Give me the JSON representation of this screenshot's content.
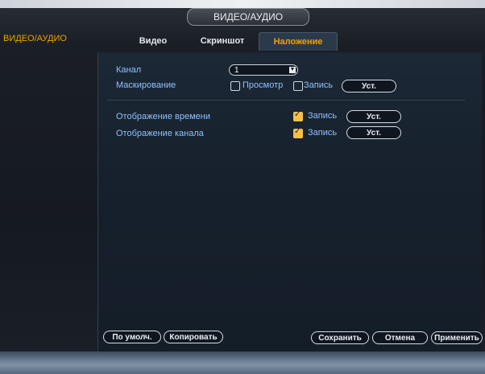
{
  "window": {
    "title": "ВИДЕО/АУДИО"
  },
  "sidebar": {
    "items": [
      {
        "label": "ВИДЕО/АУДИО",
        "active": true
      }
    ]
  },
  "tabs": [
    {
      "label": "Видео",
      "active": false
    },
    {
      "label": "Скриншот",
      "active": false
    },
    {
      "label": "Наложение",
      "active": true
    }
  ],
  "overlay": {
    "channel": {
      "label": "Канал",
      "value": "1"
    },
    "masking": {
      "label": "Маскирование",
      "preview": {
        "label": "Просмотр",
        "checked": false
      },
      "record": {
        "label": "Запись",
        "checked": false
      },
      "setup_label": "Уст."
    },
    "time_display": {
      "label": "Отображение времени",
      "record": {
        "label": "Запись",
        "checked": true
      },
      "setup_label": "Уст."
    },
    "channel_display": {
      "label": "Отображение канала",
      "record": {
        "label": "Запись",
        "checked": true
      },
      "setup_label": "Уст."
    }
  },
  "footer": {
    "default_label": "По умолч.",
    "copy_label": "Копировать",
    "save_label": "Сохранить",
    "cancel_label": "Отмена",
    "apply_label": "Применить"
  },
  "colors": {
    "accent": "#f0a000",
    "label_blue": "#8fc1ff",
    "panel": "#17212d",
    "checkbox_checked": "#f5c04a"
  }
}
